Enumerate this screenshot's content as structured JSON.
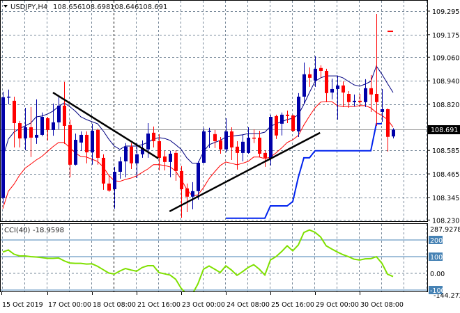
{
  "header": {
    "symbol": "USDJPY,H4",
    "open": "108.656",
    "high": "108.698",
    "low": "108.646",
    "close": "108.691"
  },
  "colors": {
    "bull": "#0000a8",
    "bear": "#ff0000",
    "ma_upper": "#000080",
    "ma_lower": "#ff0000",
    "stop_line": "#0022ee",
    "trendline": "#000000",
    "cci_line": "#7fe000",
    "cci_levels": "#4682b4",
    "grid": "#778899"
  },
  "price_axis": {
    "labels": [
      "109.295",
      "109.175",
      "109.060",
      "108.940",
      "108.820",
      "108.585",
      "108.465",
      "108.345",
      "108.230"
    ],
    "current_price": "108.691"
  },
  "time_axis": {
    "labels": [
      "15 Oct 2019",
      "17 Oct 00:00",
      "18 Oct 08:00",
      "21 Oct 16:00",
      "23 Oct 00:00",
      "24 Oct 08:00",
      "25 Oct 16:00",
      "29 Oct 00:00",
      "30 Oct 08:00"
    ]
  },
  "cci": {
    "title": "CCI(40)",
    "value": "-18.9598",
    "scale_max": "287.9278",
    "scale_min": "-144.2726",
    "levels": [
      "200",
      "100",
      "0.00",
      "-100"
    ]
  },
  "chart_data": {
    "type": "candlestick",
    "timeframe": "H4",
    "ylim": [
      108.23,
      109.295
    ],
    "candles": [
      [
        108.342,
        108.884,
        108.313,
        108.856
      ],
      [
        108.856,
        108.895,
        108.82,
        108.859
      ],
      [
        108.838,
        108.859,
        108.6,
        108.724
      ],
      [
        108.724,
        108.735,
        108.6,
        108.646
      ],
      [
        108.646,
        108.802,
        108.586,
        108.703
      ],
      [
        108.703,
        108.806,
        108.551,
        108.65
      ],
      [
        108.65,
        108.845,
        108.618,
        108.664
      ],
      [
        108.664,
        108.778,
        108.657,
        108.756
      ],
      [
        108.749,
        108.756,
        108.636,
        108.689
      ],
      [
        108.689,
        108.824,
        108.66,
        108.728
      ],
      [
        108.728,
        108.859,
        108.692,
        108.813
      ],
      [
        108.813,
        108.934,
        108.618,
        108.71
      ],
      [
        108.714,
        108.742,
        108.448,
        108.512
      ],
      [
        108.512,
        108.671,
        108.508,
        108.639
      ],
      [
        108.625,
        108.682,
        108.583,
        108.664
      ],
      [
        108.664,
        108.682,
        108.519,
        108.575
      ],
      [
        108.575,
        108.721,
        108.512,
        108.685
      ],
      [
        108.689,
        108.696,
        108.512,
        108.547
      ],
      [
        108.547,
        108.565,
        108.384,
        108.416
      ],
      [
        108.416,
        108.458,
        108.374,
        108.38
      ],
      [
        108.387,
        108.501,
        108.288,
        108.476
      ],
      [
        108.476,
        108.551,
        108.441,
        108.529
      ],
      [
        108.529,
        108.622,
        108.448,
        108.604
      ],
      [
        108.604,
        108.622,
        108.49,
        108.519
      ],
      [
        108.519,
        108.622,
        108.444,
        108.565
      ],
      [
        108.565,
        108.636,
        108.547,
        108.597
      ],
      [
        108.59,
        108.724,
        108.547,
        108.671
      ],
      [
        108.675,
        108.707,
        108.6,
        108.632
      ],
      [
        108.632,
        108.668,
        108.483,
        108.547
      ],
      [
        108.554,
        108.583,
        108.483,
        108.526
      ],
      [
        108.526,
        108.583,
        108.448,
        108.568
      ],
      [
        108.572,
        108.586,
        108.43,
        108.48
      ],
      [
        108.48,
        108.505,
        108.242,
        108.387
      ],
      [
        108.391,
        108.416,
        108.27,
        108.349
      ],
      [
        108.349,
        108.423,
        108.285,
        108.377
      ],
      [
        108.377,
        108.529,
        108.334,
        108.522
      ],
      [
        108.522,
        108.7,
        108.519,
        108.682
      ],
      [
        108.682,
        108.7,
        108.597,
        108.685
      ],
      [
        108.668,
        108.689,
        108.597,
        108.632
      ],
      [
        108.636,
        108.653,
        108.568,
        108.59
      ],
      [
        108.59,
        108.749,
        108.575,
        108.682
      ],
      [
        108.682,
        108.703,
        108.536,
        108.6
      ],
      [
        108.604,
        108.632,
        108.487,
        108.572
      ],
      [
        108.572,
        108.668,
        108.529,
        108.629
      ],
      [
        108.572,
        108.703,
        108.568,
        108.65
      ],
      [
        108.65,
        108.692,
        108.622,
        108.646
      ],
      [
        108.65,
        108.685,
        108.551,
        108.568
      ],
      [
        108.572,
        108.586,
        108.501,
        108.547
      ],
      [
        108.543,
        108.767,
        108.508,
        108.756
      ],
      [
        108.76,
        108.767,
        108.643,
        108.661
      ],
      [
        108.721,
        108.778,
        108.661,
        108.767
      ],
      [
        108.767,
        108.788,
        108.724,
        108.76
      ],
      [
        108.763,
        108.767,
        108.678,
        108.685
      ],
      [
        108.682,
        108.877,
        108.653,
        108.859
      ],
      [
        108.859,
        109.033,
        108.824,
        108.973
      ],
      [
        108.973,
        109.008,
        108.909,
        108.955
      ],
      [
        108.941,
        109.065,
        108.909,
        109.001
      ],
      [
        109.005,
        109.019,
        108.955,
        108.99
      ],
      [
        108.99,
        109.001,
        108.831,
        108.877
      ],
      [
        108.88,
        108.951,
        108.845,
        108.898
      ],
      [
        108.898,
        108.966,
        108.742,
        108.916
      ],
      [
        108.916,
        108.937,
        108.806,
        108.88
      ],
      [
        108.873,
        108.887,
        108.802,
        108.831
      ],
      [
        108.831,
        108.87,
        108.809,
        108.838
      ],
      [
        108.838,
        108.873,
        108.809,
        108.831
      ],
      [
        108.831,
        108.948,
        108.806,
        108.902
      ],
      [
        108.902,
        108.969,
        108.781,
        108.87
      ],
      [
        108.873,
        109.281,
        108.71,
        108.831
      ],
      [
        108.781,
        108.898,
        108.731,
        108.795
      ],
      [
        108.795,
        108.799,
        108.579,
        108.654
      ],
      [
        108.656,
        108.698,
        108.646,
        108.691
      ]
    ],
    "ma_upper": [
      108.547,
      108.643,
      108.678,
      108.696,
      108.71,
      108.724,
      108.756,
      108.76,
      108.77,
      108.785,
      108.809,
      108.827,
      108.809,
      108.785,
      108.756,
      108.742,
      108.731,
      108.721,
      108.685,
      108.643,
      108.607,
      108.59,
      108.607,
      108.607,
      108.607,
      108.614,
      108.625,
      108.643,
      108.65,
      108.646,
      108.636,
      108.614,
      108.59,
      108.547,
      108.519,
      108.519,
      108.579,
      108.614,
      108.625,
      108.636,
      108.653,
      108.657,
      108.661,
      108.664,
      108.671,
      108.671,
      108.671,
      108.678,
      108.707,
      108.721,
      108.731,
      108.742,
      108.749,
      108.767,
      108.82,
      108.88,
      108.937,
      108.955,
      108.965,
      108.965,
      108.965,
      108.955,
      108.937,
      108.919,
      108.912,
      108.923,
      108.937,
      109.015,
      108.973,
      108.926,
      108.88
    ],
    "ma_lower": [
      108.288,
      108.377,
      108.412,
      108.458,
      108.494,
      108.515,
      108.536,
      108.554,
      108.579,
      108.604,
      108.625,
      108.625,
      108.6,
      108.572,
      108.554,
      108.551,
      108.54,
      108.529,
      108.501,
      108.458,
      108.43,
      108.427,
      108.437,
      108.444,
      108.455,
      108.473,
      108.49,
      108.512,
      108.512,
      108.508,
      108.501,
      108.48,
      108.437,
      108.387,
      108.352,
      108.359,
      108.395,
      108.441,
      108.476,
      108.508,
      108.526,
      108.519,
      108.512,
      108.519,
      108.529,
      108.551,
      108.551,
      108.543,
      108.551,
      108.572,
      108.597,
      108.625,
      108.639,
      108.661,
      108.714,
      108.76,
      108.802,
      108.831,
      108.834,
      108.834,
      108.813,
      108.809,
      108.809,
      108.809,
      108.813,
      108.813,
      108.802,
      108.778,
      108.763,
      108.742,
      108.703
    ],
    "stop_line": {
      "start_candle": 41,
      "values": [
        108.239,
        108.239,
        108.239,
        108.239,
        108.239,
        108.239,
        108.239,
        108.239,
        108.302,
        108.302,
        108.302,
        108.302,
        108.324,
        108.448,
        108.547,
        108.547,
        108.583,
        108.583,
        108.583,
        108.583,
        108.583,
        108.583,
        108.583,
        108.583,
        108.583,
        108.583,
        108.583,
        108.721,
        108.721
      ]
    },
    "trendlines": [
      {
        "from": [
          10,
          108.88
        ],
        "to": [
          28.9,
          108.544
        ]
      },
      {
        "from": [
          30.9,
          108.274
        ],
        "to": [
          57.9,
          108.675
        ]
      }
    ],
    "marker": {
      "candles": [
        70,
        71
      ],
      "price": 109.192
    },
    "cci_values": [
      128,
      140,
      115,
      104,
      104,
      100,
      98,
      94,
      90,
      90,
      92,
      75,
      62,
      60,
      60,
      56,
      57,
      42,
      22,
      2,
      -4,
      14,
      29,
      20,
      13,
      35,
      46,
      46,
      5,
      -3,
      -10,
      -35,
      -90,
      -125,
      -124,
      -63,
      25,
      44,
      25,
      5,
      45,
      20,
      -12,
      10,
      35,
      52,
      25,
      -10,
      80,
      100,
      130,
      165,
      135,
      170,
      245,
      260,
      246,
      218,
      165,
      146,
      128,
      112,
      100,
      85,
      80,
      87,
      88,
      100,
      60,
      -5,
      -19
    ],
    "cci_range": [
      -144.2726,
      287.9278
    ]
  }
}
